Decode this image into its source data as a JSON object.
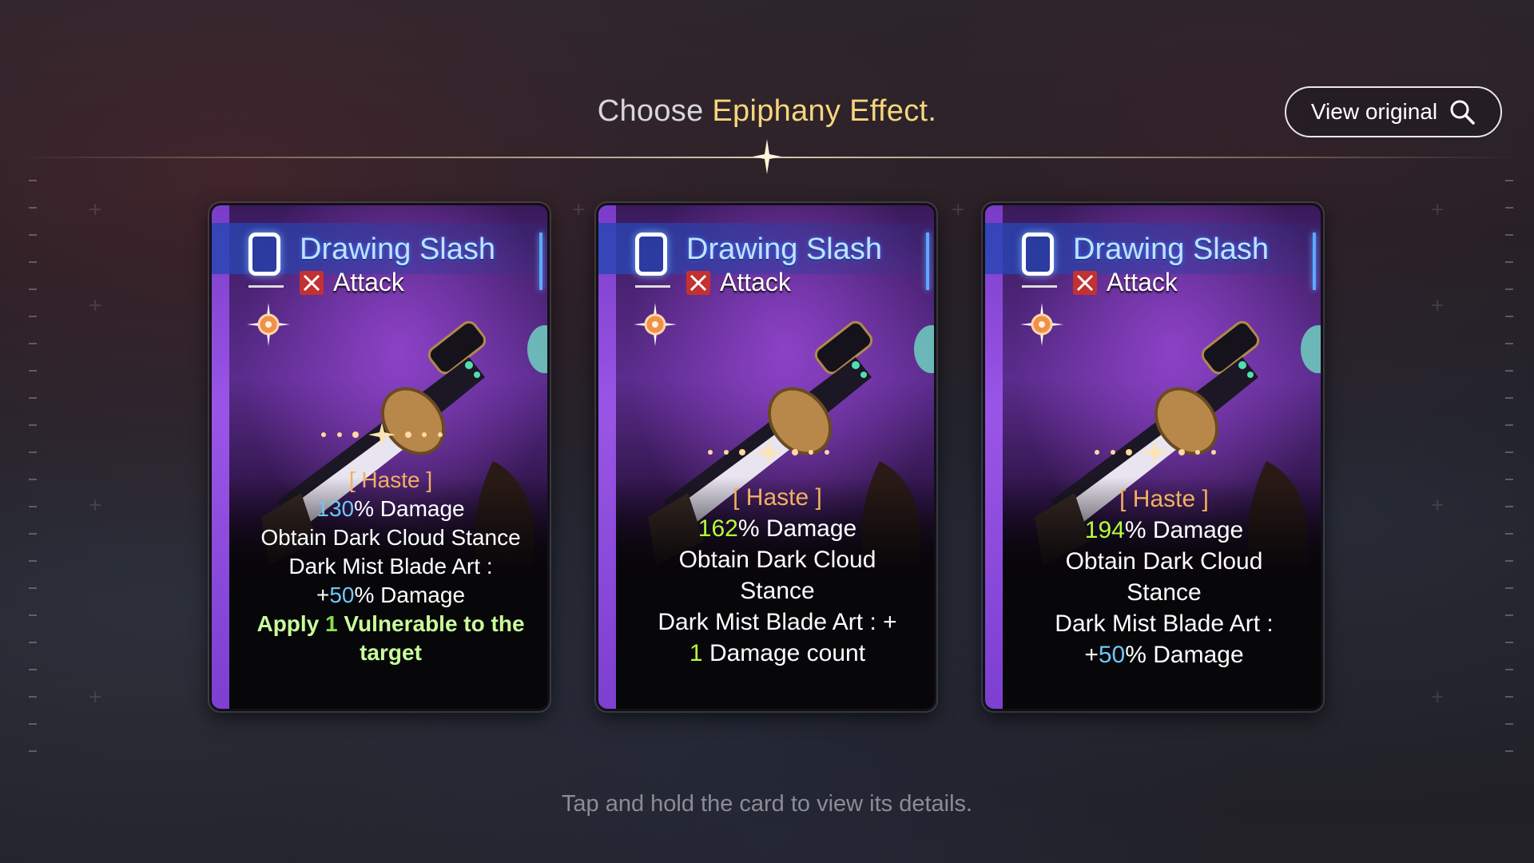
{
  "header": {
    "title_prefix": "Choose ",
    "title_highlight": "Epiphany Effect",
    "title_suffix": ".",
    "view_original_label": "View original"
  },
  "cards": [
    {
      "name": "Drawing Slash",
      "type": "Attack",
      "cost": "0",
      "tag": "[ Haste ]",
      "damage_value": "130",
      "damage_suffix": "% Damage",
      "stance_line": "Obtain Dark Cloud Stance",
      "art_line": "Dark Mist Blade Art :",
      "bonus_prefix": "+",
      "bonus_value": "50",
      "bonus_suffix": "% Damage",
      "extra_prefix": "Apply ",
      "extra_value": "1",
      "extra_suffix": " Vulnerable to the",
      "extra_line2": "target"
    },
    {
      "name": "Drawing Slash",
      "type": "Attack",
      "cost": "0",
      "tag": "[ Haste ]",
      "damage_value": "162",
      "damage_suffix": "% Damage",
      "stance_line1": "Obtain Dark Cloud",
      "stance_line2": "Stance",
      "art_line": "Dark Mist Blade Art : +",
      "count_value": "1",
      "count_suffix": " Damage count"
    },
    {
      "name": "Drawing Slash",
      "type": "Attack",
      "cost": "0",
      "tag": "[ Haste ]",
      "damage_value": "194",
      "damage_suffix": "% Damage",
      "stance_line1": "Obtain Dark Cloud",
      "stance_line2": "Stance",
      "art_line": "Dark Mist Blade Art :",
      "bonus_prefix": "+",
      "bonus_value": "50",
      "bonus_suffix": "% Damage"
    }
  ],
  "hint": "Tap and hold the card to view its details.",
  "colors": {
    "title_highlight": "#f6d57c",
    "card_name": "#bfe2ff",
    "haste": "#f0b060",
    "value_blue": "#6ec7f5",
    "value_green": "#b6ff3a"
  },
  "icons": [
    "search-icon",
    "attack-icon",
    "compass-icon",
    "sparkle-icon"
  ]
}
